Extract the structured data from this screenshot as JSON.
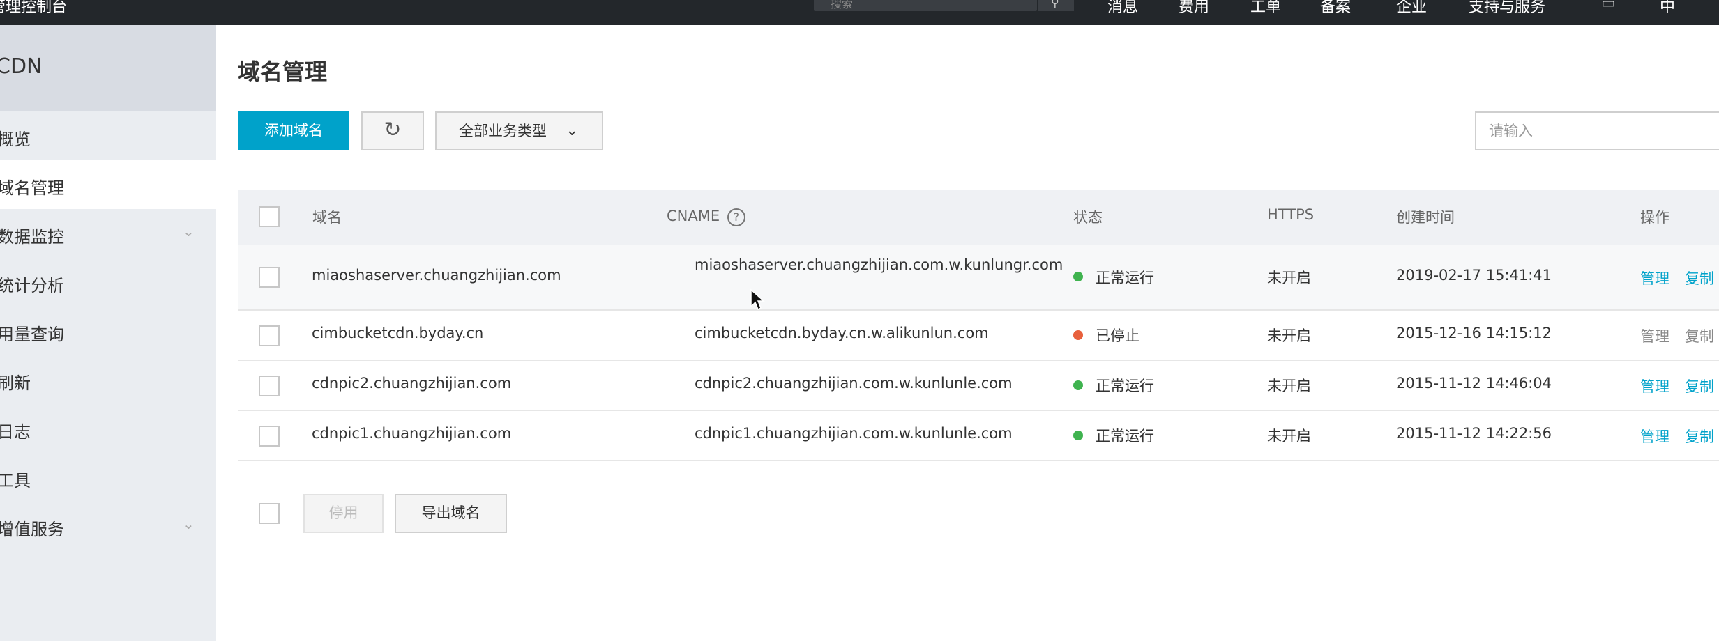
{
  "topbar": {
    "brand": "管理控制台",
    "search_placeholder": "搜索",
    "search_icon": "search-icon",
    "nav": [
      "消息",
      "费用",
      "工单",
      "备案",
      "企业",
      "支持与服务"
    ],
    "icons": [
      "cart-icon",
      "language-icon"
    ]
  },
  "sidebar": {
    "title": "CDN",
    "items": [
      {
        "label": "概览"
      },
      {
        "label": "域名管理",
        "active": true
      },
      {
        "label": "数据监控",
        "expandable": true
      },
      {
        "label": "统计分析"
      },
      {
        "label": "用量查询"
      },
      {
        "label": "刷新"
      },
      {
        "label": "日志"
      },
      {
        "label": "工具"
      },
      {
        "label": "增值服务",
        "expandable": true
      }
    ]
  },
  "main": {
    "title": "域名管理",
    "toolbar": {
      "add_label": "添加域名",
      "refresh_icon": "refresh-icon",
      "type_select": "全部业务类型",
      "search_placeholder": "请输入"
    },
    "table": {
      "headers": [
        "域名",
        "CNAME",
        "状态",
        "HTTPS",
        "创建时间",
        "操作"
      ],
      "rows": [
        {
          "domain": "miaoshaserver.chuangzhijian.com",
          "cname": "miaoshaserver.chuangzhijian.com.w.kunlungr.com",
          "status": "正常运行",
          "status_color": "#3fb34f",
          "https": "未开启",
          "created": "2019-02-17 15:41:41",
          "action_manage": "管理",
          "action_copy": "复制",
          "enabled": true
        },
        {
          "domain": "cimbucketcdn.byday.cn",
          "cname": "cimbucketcdn.byday.cn.w.alikunlun.com",
          "status": "已停止",
          "status_color": "#e8603c",
          "https": "未开启",
          "created": "2015-12-16 14:15:12",
          "action_manage": "管理",
          "action_copy": "复制",
          "enabled": false
        },
        {
          "domain": "cdnpic2.chuangzhijian.com",
          "cname": "cdnpic2.chuangzhijian.com.w.kunlunle.com",
          "status": "正常运行",
          "status_color": "#3fb34f",
          "https": "未开启",
          "created": "2015-11-12 14:46:04",
          "action_manage": "管理",
          "action_copy": "复制",
          "enabled": true
        },
        {
          "domain": "cdnpic1.chuangzhijian.com",
          "cname": "cdnpic1.chuangzhijian.com.w.kunlunle.com",
          "status": "正常运行",
          "status_color": "#3fb34f",
          "https": "未开启",
          "created": "2015-11-12 14:22:56",
          "action_manage": "管理",
          "action_copy": "复制",
          "enabled": true
        }
      ]
    },
    "footer": {
      "disable_label": "停用",
      "export_label": "导出域名"
    }
  }
}
